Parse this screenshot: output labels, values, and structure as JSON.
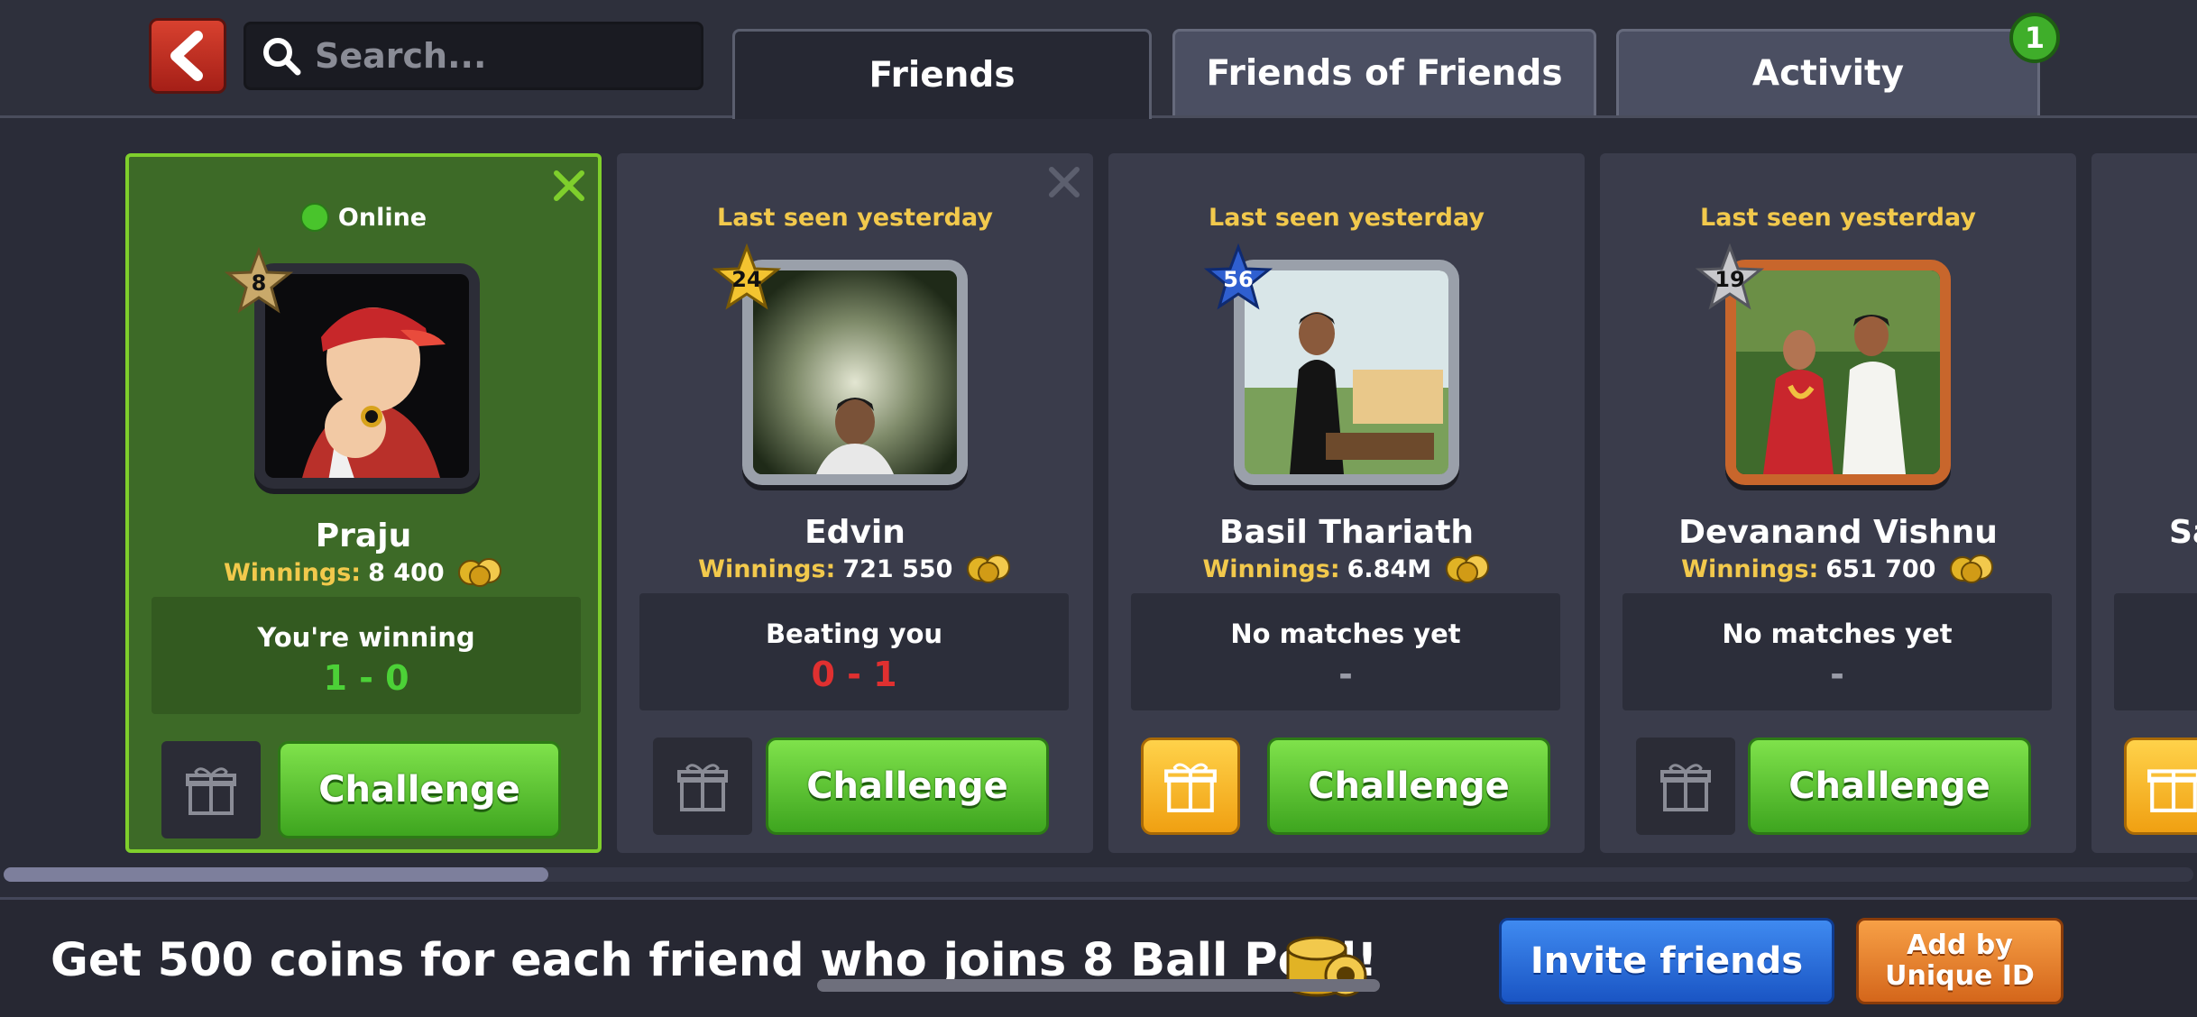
{
  "header": {
    "search_placeholder": "Search...",
    "tabs": [
      {
        "label": "Friends",
        "active": true
      },
      {
        "label": "Friends of Friends",
        "active": false
      },
      {
        "label": "Activity",
        "active": false,
        "badge": "1"
      }
    ]
  },
  "cards": [
    {
      "status": "Online",
      "level": "8",
      "name": "Praju",
      "winnings_label": "Winnings:",
      "winnings": "8 400",
      "record_label": "You're winning",
      "record_score": "1 - 0",
      "score_color": "#4cd137",
      "challenge_label": "Challenge"
    },
    {
      "status": "Last seen yesterday",
      "level": "24",
      "name": "Edvin",
      "winnings_label": "Winnings:",
      "winnings": "721 550",
      "record_label": "Beating you",
      "record_score": "0 - 1",
      "score_color": "#e03030",
      "challenge_label": "Challenge"
    },
    {
      "status": "Last seen yesterday",
      "level": "56",
      "name": "Basil Thariath",
      "winnings_label": "Winnings:",
      "winnings": "6.84M",
      "record_label": "No matches yet",
      "record_score": "-",
      "score_color": "#9a9ca8",
      "challenge_label": "Challenge"
    },
    {
      "status": "Last seen yesterday",
      "level": "19",
      "name": "Devanand Vishnu",
      "winnings_label": "Winnings:",
      "winnings": "651 700",
      "record_label": "No matches yet",
      "record_score": "-",
      "score_color": "#9a9ca8",
      "challenge_label": "Challenge"
    },
    {
      "name": "Sa"
    }
  ],
  "footer": {
    "promo_text": "Get 500 coins for each friend who joins 8 Ball Pool!",
    "invite_label": "Invite friends",
    "add_id_line1": "Add by",
    "add_id_line2": "Unique ID"
  },
  "icons": {
    "back": "chevron-left-icon",
    "search": "search-icon",
    "close": "close-icon",
    "gift": "gift-icon",
    "coins": "coins-icon",
    "online": "online-dot-icon"
  },
  "colors": {
    "accent_green": "#4cd137",
    "accent_gold": "#f2c94c",
    "invite_blue": "#2a6ee0",
    "add_orange": "#e67a2a",
    "back_red": "#c3311f"
  }
}
